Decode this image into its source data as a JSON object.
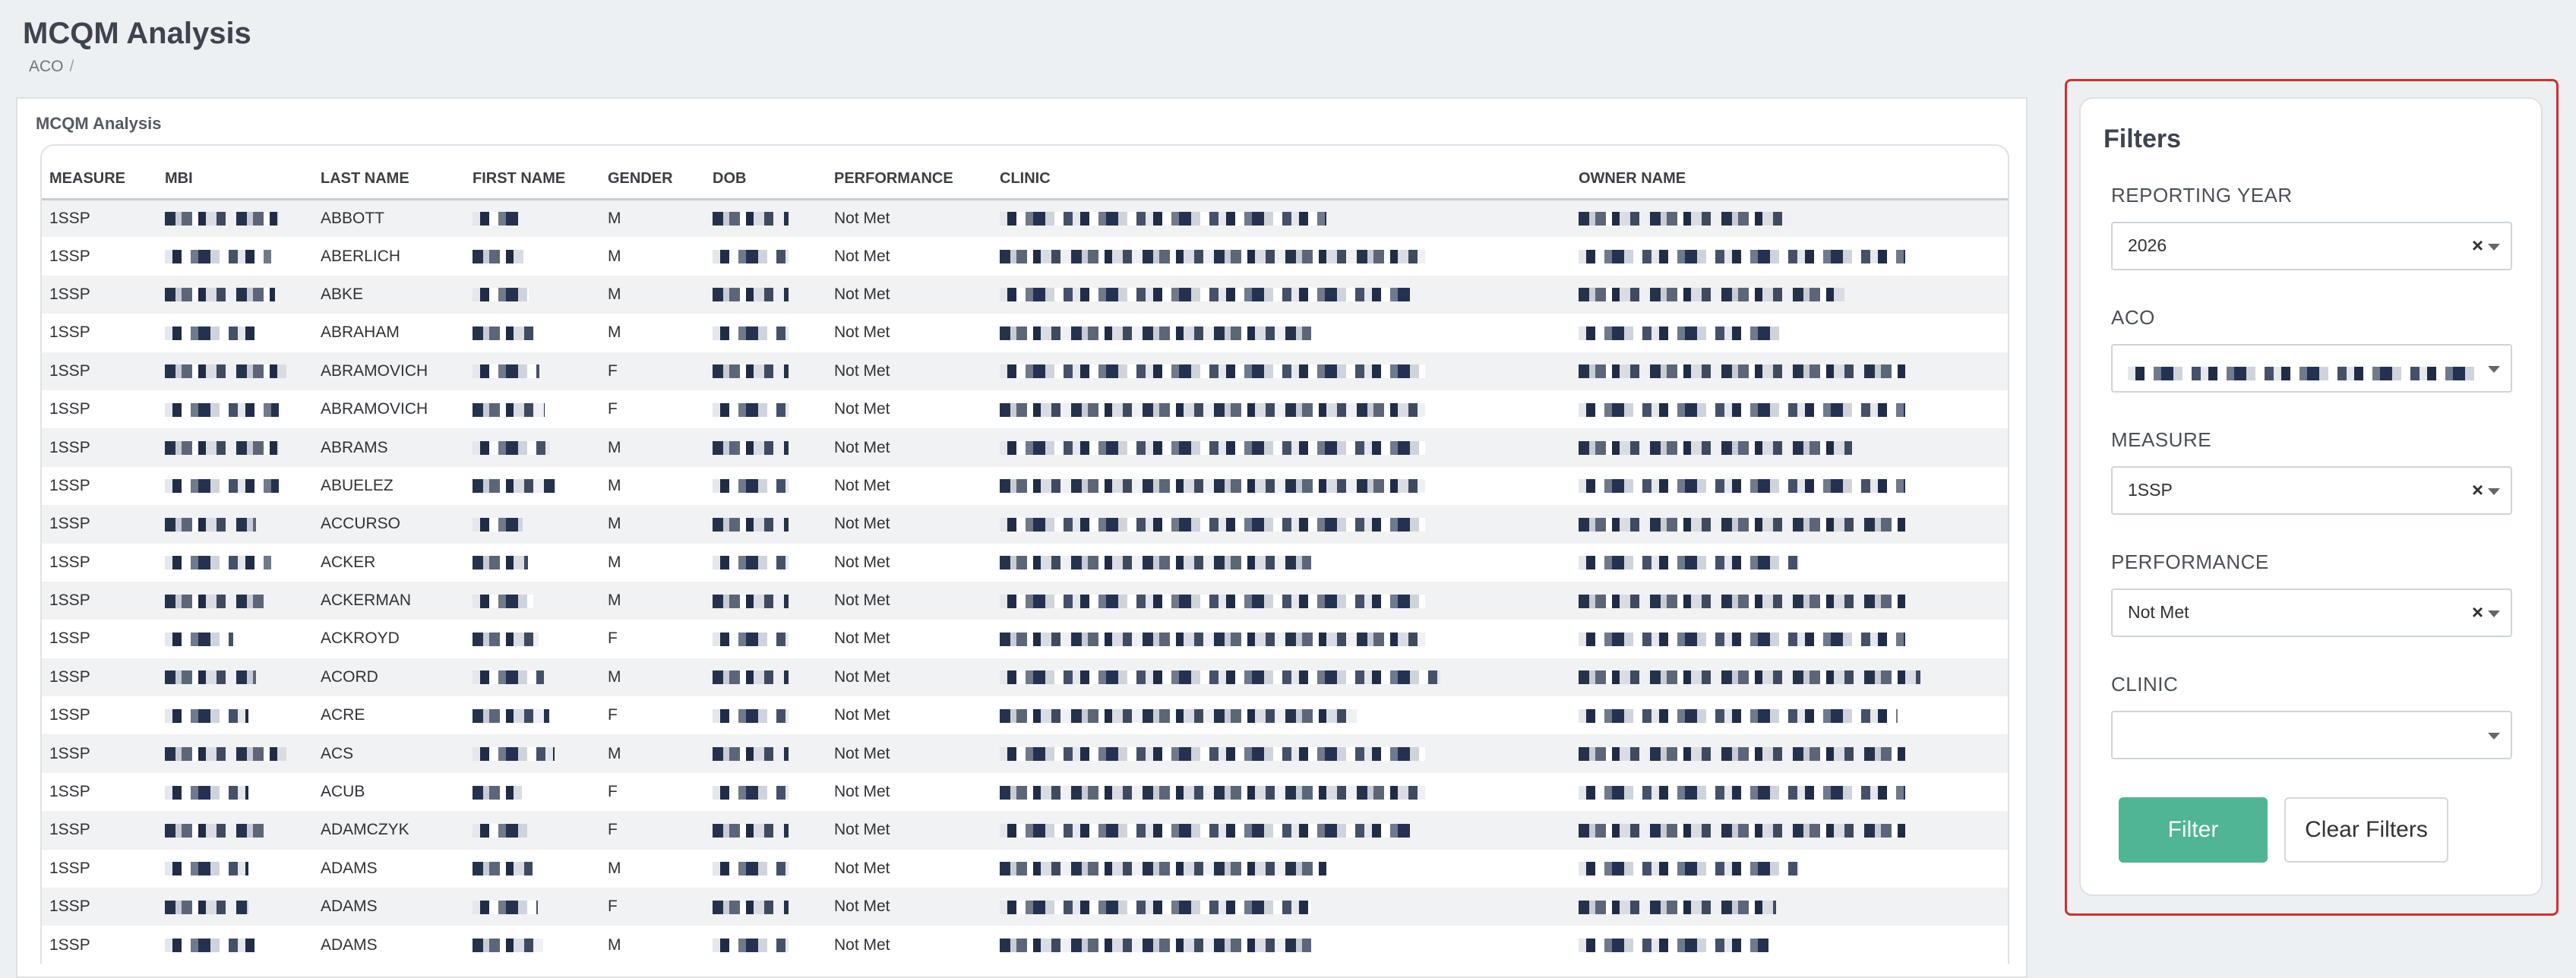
{
  "header": {
    "title": "MCQM Analysis",
    "breadcrumb": [
      "ACO"
    ],
    "breadcrumb_sep": "/"
  },
  "main": {
    "card_title": "MCQM Analysis",
    "columns": [
      "MEASURE",
      "MBI",
      "LAST NAME",
      "FIRST NAME",
      "GENDER",
      "DOB",
      "PERFORMANCE",
      "CLINIC",
      "OWNER NAME"
    ],
    "rows": [
      {
        "measure": "1SSP",
        "last_name": "ABBOTT",
        "gender": "M",
        "performance": "Not Met"
      },
      {
        "measure": "1SSP",
        "last_name": "ABERLICH",
        "gender": "M",
        "performance": "Not Met"
      },
      {
        "measure": "1SSP",
        "last_name": "ABKE",
        "gender": "M",
        "performance": "Not Met"
      },
      {
        "measure": "1SSP",
        "last_name": "ABRAHAM",
        "gender": "M",
        "performance": "Not Met"
      },
      {
        "measure": "1SSP",
        "last_name": "ABRAMOVICH",
        "gender": "F",
        "performance": "Not Met"
      },
      {
        "measure": "1SSP",
        "last_name": "ABRAMOVICH",
        "gender": "F",
        "performance": "Not Met"
      },
      {
        "measure": "1SSP",
        "last_name": "ABRAMS",
        "gender": "M",
        "performance": "Not Met"
      },
      {
        "measure": "1SSP",
        "last_name": "ABUELEZ",
        "gender": "M",
        "performance": "Not Met"
      },
      {
        "measure": "1SSP",
        "last_name": "ACCURSO",
        "gender": "M",
        "performance": "Not Met"
      },
      {
        "measure": "1SSP",
        "last_name": "ACKER",
        "gender": "M",
        "performance": "Not Met"
      },
      {
        "measure": "1SSP",
        "last_name": "ACKERMAN",
        "gender": "M",
        "performance": "Not Met"
      },
      {
        "measure": "1SSP",
        "last_name": "ACKROYD",
        "gender": "F",
        "performance": "Not Met"
      },
      {
        "measure": "1SSP",
        "last_name": "ACORD",
        "gender": "M",
        "performance": "Not Met"
      },
      {
        "measure": "1SSP",
        "last_name": "ACRE",
        "gender": "F",
        "performance": "Not Met"
      },
      {
        "measure": "1SSP",
        "last_name": "ACS",
        "gender": "M",
        "performance": "Not Met"
      },
      {
        "measure": "1SSP",
        "last_name": "ACUB",
        "gender": "F",
        "performance": "Not Met"
      },
      {
        "measure": "1SSP",
        "last_name": "ADAMCZYK",
        "gender": "F",
        "performance": "Not Met"
      },
      {
        "measure": "1SSP",
        "last_name": "ADAMS",
        "gender": "M",
        "performance": "Not Met"
      },
      {
        "measure": "1SSP",
        "last_name": "ADAMS",
        "gender": "F",
        "performance": "Not Met"
      },
      {
        "measure": "1SSP",
        "last_name": "ADAMS",
        "gender": "M",
        "performance": "Not Met"
      }
    ]
  },
  "filters": {
    "title": "Filters",
    "reporting_year": {
      "label": "REPORTING YEAR",
      "value": "2026"
    },
    "aco": {
      "label": "ACO",
      "value": ""
    },
    "measure": {
      "label": "MEASURE",
      "value": "1SSP"
    },
    "performance": {
      "label": "PERFORMANCE",
      "value": "Not Met"
    },
    "clinic": {
      "label": "CLINIC",
      "value": ""
    },
    "clear_symbol": "×",
    "filter_button": "Filter",
    "clear_button": "Clear Filters",
    "accent_color": "#4fb594",
    "highlight_color": "#d32f2f"
  }
}
